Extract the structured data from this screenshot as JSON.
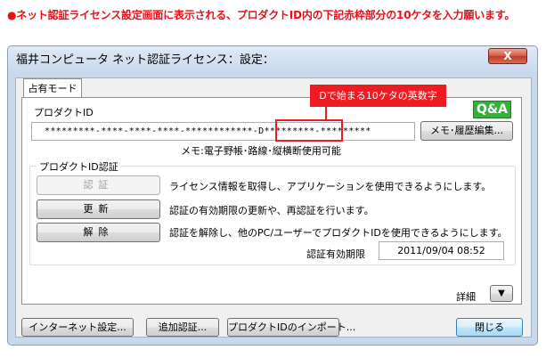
{
  "instruction": "●ネット認証ライセンス設定画面に表示される、プロダクトID内の下記赤枠部分の10ケタを入力願います。",
  "window": {
    "title": "福井コンピュータ ネット認証ライセンス：設定：",
    "close_label": "X"
  },
  "tab": {
    "label": "占有モード"
  },
  "product": {
    "label": "プロダクトID",
    "qa_label": "Q&A",
    "callout": "Dで始まる10ケタの英数字",
    "id_value": "*********-****-****-****-************-D*********-*********",
    "memo_button": "メモ･履歴編集...",
    "memo_text": "メモ:電子野帳･路線･縦横断使用可能"
  },
  "auth_group": {
    "label": "プロダクトID認証",
    "buttons": [
      {
        "label": "認証",
        "desc": "ライセンス情報を取得し、アプリケーションを使用できるようにします。"
      },
      {
        "label": "更新",
        "desc": "認証の有効期限の更新や、再認証を行います。"
      },
      {
        "label": "解除",
        "desc": "認証を解除し、他のPC/ユーザーでプロダクトIDを使用できるようにします。"
      }
    ],
    "expiry_label": "認証有効期限",
    "expiry_value": "2011/09/04 08:52"
  },
  "detail": {
    "label": "詳細",
    "icon": "triangle-down-icon"
  },
  "footer": {
    "internet_settings": "インターネット設定...",
    "add_auth": "追加認証...",
    "import_pid": "プロダクトIDのインポート...",
    "close": "閉じる"
  },
  "colors": {
    "accent_red": "#ef1b23",
    "qa_green": "#35b03a"
  }
}
